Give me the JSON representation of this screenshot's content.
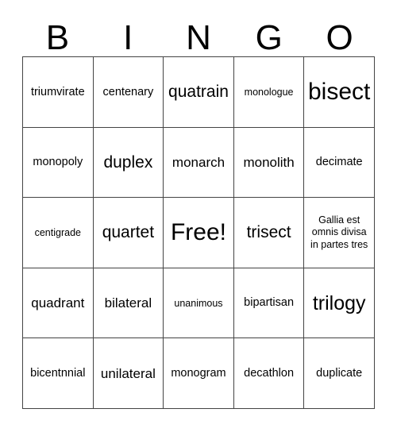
{
  "card": {
    "header_letters": [
      "B",
      "I",
      "N",
      "G",
      "O"
    ],
    "columns": 5,
    "rows": 5,
    "free_space_label": "Free!",
    "border_color": "#444444",
    "background_color": "#ffffff",
    "text_color": "#000000",
    "rows_data": [
      [
        {
          "text": "triumvirate",
          "size": "fs-s"
        },
        {
          "text": "centenary",
          "size": "fs-s"
        },
        {
          "text": "quatrain",
          "size": "fs-l"
        },
        {
          "text": "monologue",
          "size": "fs-xs"
        },
        {
          "text": "bisect",
          "size": "fs-xxl"
        }
      ],
      [
        {
          "text": "monopoly",
          "size": "fs-s"
        },
        {
          "text": "duplex",
          "size": "fs-l"
        },
        {
          "text": "monarch",
          "size": "fs-m"
        },
        {
          "text": "monolith",
          "size": "fs-m"
        },
        {
          "text": "decimate",
          "size": "fs-s"
        }
      ],
      [
        {
          "text": "centigrade",
          "size": "fs-xs"
        },
        {
          "text": "quartet",
          "size": "fs-l"
        },
        {
          "text": "Free!",
          "size": "fs-free"
        },
        {
          "text": "trisect",
          "size": "fs-l"
        },
        {
          "text": "Gallia est omnis divisa in partes tres",
          "size": "multiline"
        }
      ],
      [
        {
          "text": "quadrant",
          "size": "fs-m"
        },
        {
          "text": "bilateral",
          "size": "fs-m"
        },
        {
          "text": "unanimous",
          "size": "fs-xs"
        },
        {
          "text": "bipartisan",
          "size": "fs-s"
        },
        {
          "text": "trilogy",
          "size": "fs-xl"
        }
      ],
      [
        {
          "text": "bicentnnial",
          "size": "fs-s"
        },
        {
          "text": "unilateral",
          "size": "fs-m"
        },
        {
          "text": "monogram",
          "size": "fs-s"
        },
        {
          "text": "decathlon",
          "size": "fs-s"
        },
        {
          "text": "duplicate",
          "size": "fs-s"
        }
      ]
    ]
  }
}
